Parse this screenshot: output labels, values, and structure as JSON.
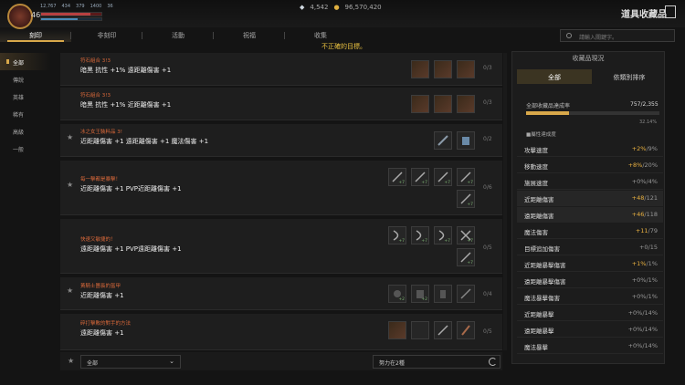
{
  "player": {
    "level": "46",
    "hp_fraction": 0.82,
    "mp_fraction": 0.6
  },
  "stats": [
    "12,767",
    "434",
    "379",
    "1400",
    "36"
  ],
  "currency": {
    "gems": "4,542",
    "gold": "96,570,420"
  },
  "window": {
    "title": "道具收藏品"
  },
  "tabs": [
    "刻印",
    "非刻印",
    "活動",
    "祝福",
    "收集"
  ],
  "hint": "不正確的目標。",
  "search": {
    "placeholder": "請輸入關鍵字。"
  },
  "sidebar": [
    "全部",
    "傳說",
    "英雄",
    "稀有",
    "高級",
    "一般"
  ],
  "rows": [
    {
      "category": "符石組合 3!3",
      "effect": "暗黑 抗性 +1% 遠距離傷害 +1",
      "count": "0/3",
      "starred": false
    },
    {
      "category": "符石組合 3!3",
      "effect": "暗黑 抗性 +1% 近距離傷害 +1",
      "count": "0/3",
      "starred": false
    },
    {
      "category": "冰之女王裝料品 3!",
      "effect": "近距離傷害 +1 遠距離傷害 +1 魔法傷害 +1",
      "count": "0/2",
      "starred": true
    },
    {
      "category": "每一擊都是暴擊！",
      "effect": "近距離傷害 +1 PVP近距離傷害 +1",
      "count": "0/6",
      "starred": true
    },
    {
      "category": "快速又敏捷的！",
      "effect": "遠距離傷害 +1 PVP遠距離傷害 +1",
      "count": "0/5",
      "starred": false
    },
    {
      "category": "黃騎士團長的盔甲",
      "effect": "近距離傷害 +1",
      "count": "0/4",
      "starred": true
    },
    {
      "category": "碎打擊敗的對手的方法",
      "effect": "遠距離傷害 +1",
      "count": "0/5",
      "starred": false
    }
  ],
  "bottom": {
    "filter": "全部",
    "input": "努力在2種"
  },
  "panel": {
    "title": "收藏品現況",
    "tabs": [
      "全部",
      "依類別排序"
    ],
    "achievement_label": "全部收藏品達成率",
    "achievement_value": "757/2,355",
    "achievement_fraction": 0.32,
    "achievement_pct": "32.14%",
    "sub_label": "■屬性達成度",
    "stats": [
      {
        "name": "攻擊速度",
        "bonus": "+2%",
        "cap": "/9%"
      },
      {
        "name": "移動速度",
        "bonus": "+8%",
        "cap": "/20%"
      },
      {
        "name": "施展速度",
        "bonus": "+0%",
        "cap": "/4%"
      },
      {
        "name": "近距離傷害",
        "bonus": "+48",
        "cap": "/121"
      },
      {
        "name": "遠距離傷害",
        "bonus": "+46",
        "cap": "/118"
      },
      {
        "name": "魔法傷害",
        "bonus": "+11",
        "cap": "/79"
      },
      {
        "name": "目標追加傷害",
        "bonus": "+0",
        "cap": "/15"
      },
      {
        "name": "近距離暴擊傷害",
        "bonus": "+1%",
        "cap": "/1%"
      },
      {
        "name": "遠距離暴擊傷害",
        "bonus": "+0%",
        "cap": "/1%"
      },
      {
        "name": "魔法暴擊傷害",
        "bonus": "+0%",
        "cap": "/1%"
      },
      {
        "name": "近距離暴擊",
        "bonus": "+0%",
        "cap": "/14%"
      },
      {
        "name": "遠距離暴擊",
        "bonus": "+0%",
        "cap": "/14%"
      },
      {
        "name": "魔法暴擊",
        "bonus": "+0%",
        "cap": "/14%"
      }
    ]
  }
}
